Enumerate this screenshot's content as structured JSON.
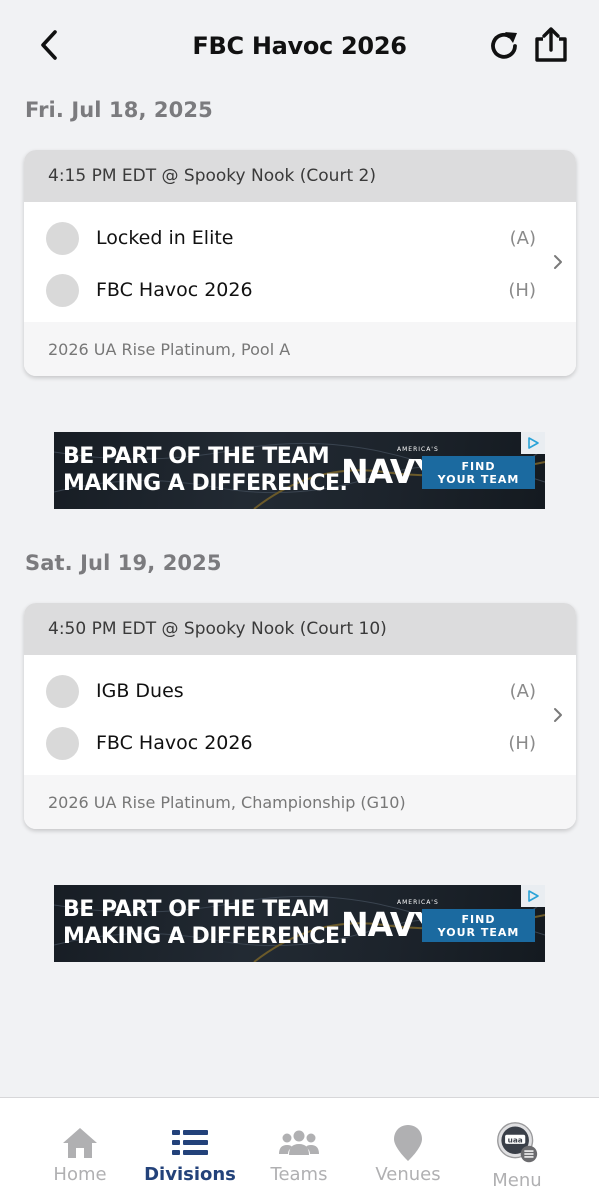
{
  "header": {
    "title": "FBC Havoc 2026"
  },
  "days": [
    {
      "date": "Fri. Jul 18, 2025",
      "game": {
        "time_venue": "4:15 PM EDT @ Spooky Nook (Court 2)",
        "teams": [
          {
            "name": "Locked in Elite",
            "side": "(A)"
          },
          {
            "name": "FBC Havoc 2026",
            "side": "(H)"
          }
        ],
        "division": "2026 UA Rise Platinum, Pool A"
      }
    },
    {
      "date": "Sat. Jul 19, 2025",
      "game": {
        "time_venue": "4:50 PM EDT @ Spooky Nook (Court 10)",
        "teams": [
          {
            "name": "IGB Dues",
            "side": "(A)"
          },
          {
            "name": "FBC Havoc 2026",
            "side": "(H)"
          }
        ],
        "division": "2026 UA Rise Platinum, Championship (G10)"
      }
    }
  ],
  "ad": {
    "headline_line1": "BE PART OF THE TEAM",
    "headline_line2": "MAKING A DIFFERENCE.",
    "brand_small": "AMERICA'S",
    "brand": "NAVY",
    "cta_line1": "FIND",
    "cta_line2": "YOUR TEAM"
  },
  "nav": {
    "items": [
      {
        "label": "Home",
        "icon": "home-icon",
        "active": false
      },
      {
        "label": "Divisions",
        "icon": "divisions-icon",
        "active": true
      },
      {
        "label": "Teams",
        "icon": "teams-icon",
        "active": false
      },
      {
        "label": "Venues",
        "icon": "venues-icon",
        "active": false
      },
      {
        "label": "Menu",
        "icon": "uaa-menu-icon",
        "active": false
      }
    ]
  },
  "colors": {
    "background": "#f1f2f4",
    "card_header": "#dcdcdd",
    "active_nav": "#23427a",
    "inactive_nav": "#b0b0b2",
    "ad_cta": "#1b6aa0"
  }
}
